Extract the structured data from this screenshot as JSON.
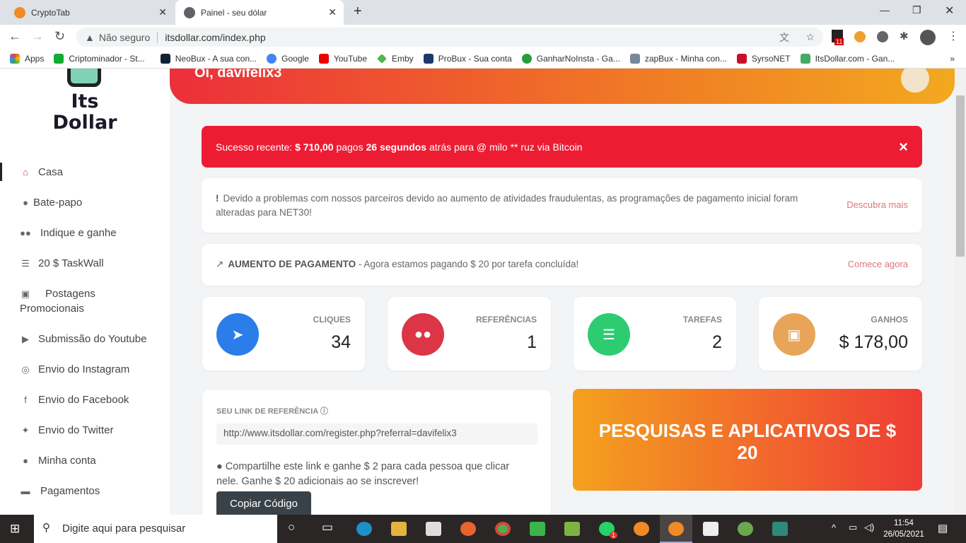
{
  "browser": {
    "tabs": [
      {
        "title": "CryptoTab",
        "active": false
      },
      {
        "title": "Painel - seu dólar",
        "active": true
      }
    ],
    "security": "Não seguro",
    "url": "itsdollar.com/index.php",
    "extension_badge": "11",
    "bookmarks": [
      "Apps",
      "Criptominador - St...",
      "NeoBux - A sua con...",
      "Google",
      "YouTube",
      "Emby",
      "ProBux - Sua conta",
      "GanharNoInsta - Ga...",
      "zapBux - Minha con...",
      "SyrsoNET",
      "ItsDollar.com - Gan..."
    ]
  },
  "sidebar": {
    "logo_line1": "Its",
    "logo_line2": "Dollar",
    "items": [
      {
        "label": "Casa",
        "icon": "home-icon",
        "active": true
      },
      {
        "label": "Bate-papo",
        "icon": "chat-icon"
      },
      {
        "label": "Indique e ganhe",
        "icon": "users-icon"
      },
      {
        "label": "20 $ TaskWall",
        "icon": "list-icon"
      },
      {
        "label": "Postagens Promocionais",
        "icon": "ad-icon"
      },
      {
        "label": "Submissão do Youtube",
        "icon": "youtube-icon"
      },
      {
        "label": "Envio do Instagram",
        "icon": "instagram-icon"
      },
      {
        "label": "Envio do Facebook",
        "icon": "facebook-icon"
      },
      {
        "label": "Envio do Twitter",
        "icon": "twitter-icon"
      },
      {
        "label": "Minha conta",
        "icon": "user-icon"
      },
      {
        "label": "Pagamentos",
        "icon": "money-icon"
      }
    ]
  },
  "header": {
    "greeting": "Oi, davifelix3"
  },
  "alert": {
    "prefix": "Sucesso recente: ",
    "amount": "$ 710,00",
    "mid": " pagos ",
    "time": "26 segundos",
    "suffix": " atrás para @ milo ** ruz via Bitcoin",
    "close": "×"
  },
  "notice": {
    "text": "Devido a problemas com nossos parceiros devido ao aumento de atividades fraudulentas, as programações de pagamento inicial foram alteradas para NET30!",
    "link": "Descubra mais"
  },
  "promo": {
    "title": "AUMENTO DE PAGAMENTO",
    "text": "- Agora estamos pagando $ 20 por tarefa concluída!",
    "link": "Comece agora"
  },
  "stats": [
    {
      "label": "CLIQUES",
      "value": "34",
      "color": "#2b7de9",
      "icon": "cursor-icon"
    },
    {
      "label": "REFERÊNCIAS",
      "value": "1",
      "color": "#dc3545",
      "icon": "users-icon"
    },
    {
      "label": "TAREFAS",
      "value": "2",
      "color": "#2ecc71",
      "icon": "tasks-icon"
    },
    {
      "label": "GANHOS",
      "value": "$ 178,00",
      "color": "#e8a55a",
      "icon": "money-icon"
    }
  ],
  "referral": {
    "title": "SEU LINK DE REFERÊNCIA",
    "link": "http://www.itsdollar.com/register.php?referral=davifelix3",
    "info": "Compartilhe este link e ganhe $ 2 para cada pessoa que clicar nele. Ganhe $ 20 adicionais ao se inscrever!",
    "button": "Copiar Código"
  },
  "surveys": {
    "title": "PESQUISAS E APLICATIVOS DE $ 20"
  },
  "taskbar": {
    "search": "Digite aqui para pesquisar",
    "time": "11:54",
    "date": "26/05/2021",
    "notification_badge": "1"
  }
}
